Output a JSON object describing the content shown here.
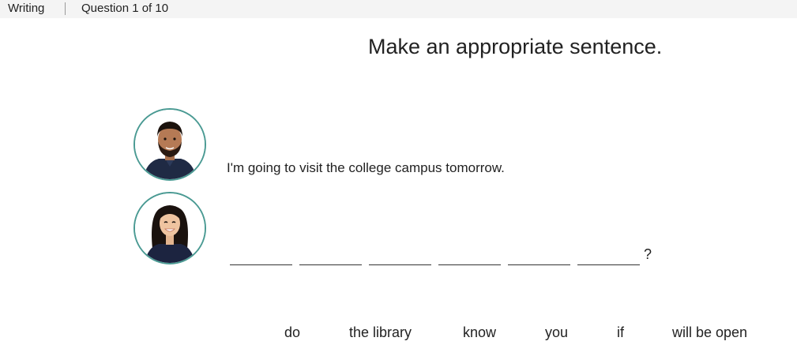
{
  "header": {
    "section_label": "Writing",
    "progress_label": "Question 1 of 10"
  },
  "question": {
    "instruction": "Make an appropriate sentence.",
    "speaker_1_text": "I'm going to visit the college campus tomorrow.",
    "blank_count": 6,
    "end_punctuation": "?"
  },
  "word_bank": [
    "do",
    "the library",
    "know",
    "you",
    "if",
    "will be open"
  ],
  "colors": {
    "topbar_bg": "#f4f4f4",
    "avatar_ring": "#4a9a93"
  }
}
